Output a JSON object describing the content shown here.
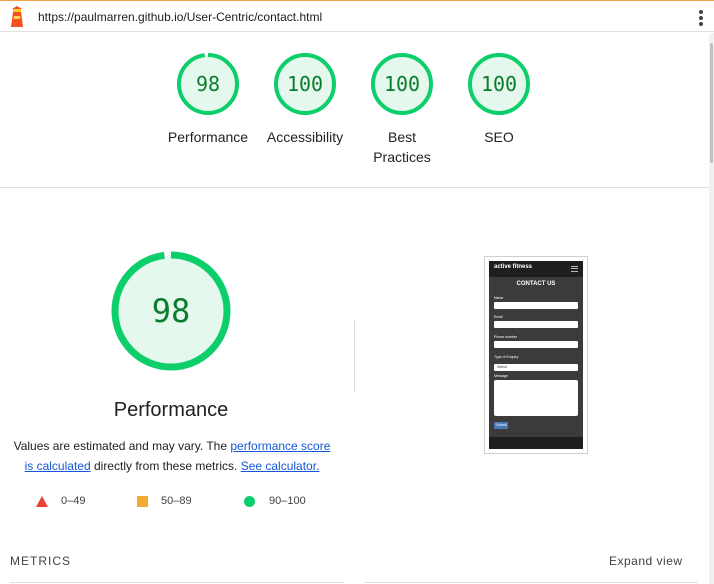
{
  "topbar": {
    "url": "https://paulmarren.github.io/User-Centric/contact.html",
    "logo_icon": "lighthouse-icon",
    "menu_icon": "more-vert-icon"
  },
  "summary": {
    "gauges": [
      {
        "value": "98",
        "score": 0.98,
        "label_lines": [
          "Performance"
        ]
      },
      {
        "value": "100",
        "score": 1.0,
        "label_lines": [
          "Accessibility"
        ]
      },
      {
        "value": "100",
        "score": 1.0,
        "label_lines": [
          "Best",
          "Practices"
        ]
      },
      {
        "value": "100",
        "score": 1.0,
        "label_lines": [
          "SEO"
        ]
      }
    ]
  },
  "performance": {
    "value": "98",
    "score": 0.98,
    "title": "Performance",
    "desc_part1": "Values are estimated and may vary. The ",
    "desc_link1": "performance score is calculated",
    "desc_part2": " directly from these metrics. ",
    "desc_link2": "See calculator.",
    "legend": [
      {
        "icon": "triangle-icon",
        "range": "0–49",
        "color": "#ea4335"
      },
      {
        "icon": "square-icon",
        "range": "50–89",
        "color": "#f4a935"
      },
      {
        "icon": "circle-icon",
        "range": "90–100",
        "color": "#0cce6b"
      }
    ]
  },
  "screenshot": {
    "brand": "active fitness",
    "title": "CONTACT US",
    "fields": [
      "Name",
      "Email",
      "Phone number"
    ],
    "select_label": "Type of Enquiry",
    "select_value": "Select",
    "message_label": "Message",
    "submit": "Submit"
  },
  "metrics": {
    "label": "METRICS",
    "expand": "Expand view"
  },
  "colors": {
    "pass": "#0cce6b",
    "pass_fill": "#e5f8ed",
    "pass_text": "#0a7d2c",
    "link": "#1558d6"
  }
}
